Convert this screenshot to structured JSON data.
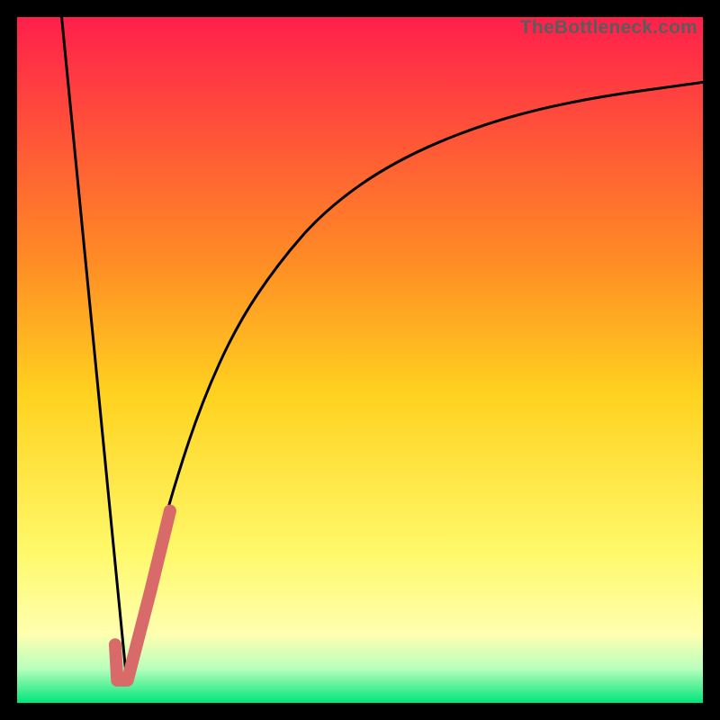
{
  "watermark": "TheBottleneck.com",
  "colors": {
    "top": "#ff1f4b",
    "mid_upper": "#ff8a25",
    "mid": "#ffd21f",
    "mid_lower": "#fff96a",
    "pale_yellow": "#ffffb0",
    "pale_green": "#b8ffbd",
    "green": "#00e57a",
    "curve": "#000000",
    "tick": "#d86a6a",
    "frame": "#000000"
  },
  "chart_data": {
    "type": "line",
    "title": "",
    "xlabel": "",
    "ylabel": "",
    "xlim": [
      0,
      100
    ],
    "ylim": [
      0,
      100
    ],
    "series": [
      {
        "name": "left-branch",
        "x": [
          6.5,
          16
        ],
        "y": [
          100,
          3
        ]
      },
      {
        "name": "right-branch",
        "x": [
          16,
          18,
          20,
          23,
          27,
          32,
          38,
          45,
          55,
          68,
          82,
          100
        ],
        "y": [
          3,
          12,
          21,
          32,
          44,
          55,
          64,
          72,
          79,
          84.5,
          88,
          90.5
        ]
      },
      {
        "name": "tick-segment",
        "x": [
          14.3,
          14.6,
          16.1,
          19.5,
          22.3
        ],
        "y": [
          8.5,
          3.3,
          3.3,
          16.5,
          28
        ]
      }
    ],
    "gradient_stops": [
      {
        "pct": 0,
        "color": "#ff1f4b"
      },
      {
        "pct": 35,
        "color": "#ff8a25"
      },
      {
        "pct": 55,
        "color": "#ffd21f"
      },
      {
        "pct": 78,
        "color": "#fff96a"
      },
      {
        "pct": 90,
        "color": "#ffffb0"
      },
      {
        "pct": 95,
        "color": "#b8ffbd"
      },
      {
        "pct": 100,
        "color": "#00e57a"
      }
    ]
  }
}
